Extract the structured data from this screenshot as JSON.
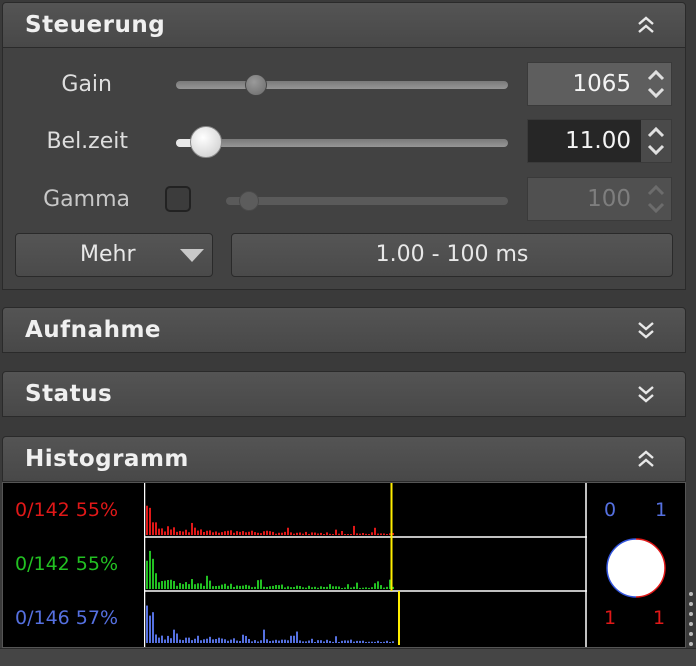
{
  "panels": {
    "steuerung": {
      "title": "Steuerung"
    },
    "aufnahme": {
      "title": "Aufnahme"
    },
    "status": {
      "title": "Status"
    },
    "histogramm": {
      "title": "Histogramm"
    }
  },
  "controls": {
    "gain": {
      "label": "Gain",
      "value": "1065",
      "slider_fraction": 0.24
    },
    "exposure": {
      "label": "Bel.zeit",
      "value": "11.00",
      "slider_fraction": 0.09
    },
    "gamma": {
      "label": "Gamma",
      "value": "100",
      "slider_fraction": 0.08,
      "checked": false,
      "enabled": false
    },
    "more_button": {
      "label": "Mehr"
    },
    "range_display": {
      "text": "1.00 - 100 ms"
    }
  },
  "histogram": {
    "channels": [
      {
        "name": "red",
        "stats": "0/142 55%",
        "color": "#e01818",
        "max_fraction": 0.99
      },
      {
        "name": "green",
        "stats": "0/142 55%",
        "color": "#22c022",
        "max_fraction": 0.99
      },
      {
        "name": "blue",
        "stats": "0/146 57%",
        "color": "#5570e0",
        "max_fraction": 1.02
      }
    ],
    "corner_values": {
      "top_left": "0",
      "top_right": "1",
      "bottom_left": "1",
      "bottom_right": "1"
    },
    "colors": {
      "top_values": "#5570e0",
      "bottom_values": "#e01818",
      "marker": "#ffee00"
    }
  }
}
